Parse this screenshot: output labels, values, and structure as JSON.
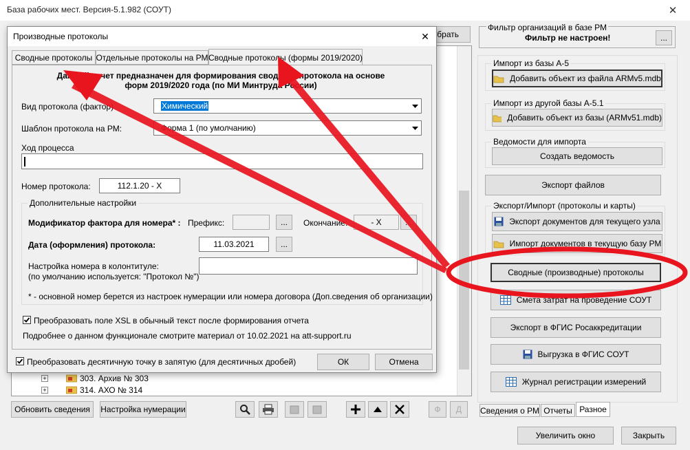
{
  "main_window": {
    "title": "База рабочих мест. Версия-5.1.982 (СОУТ)",
    "close_glyph": "✕",
    "hidden_button_label": "брать"
  },
  "tree": {
    "items": [
      {
        "text": "303. Архив № 303"
      },
      {
        "text": "314. АХО № 314"
      }
    ]
  },
  "bottom_left": {
    "refresh_label": "Обновить сведения",
    "numbering_label": "Настройка нумерации",
    "f_label": "Ф",
    "d_label": "Д"
  },
  "right_panel": {
    "filter": {
      "title": "Фильтр организаций в базе РМ",
      "status": "Фильтр не настроен!",
      "btn": "..."
    },
    "import_a5": {
      "title": "Импорт из базы А-5",
      "btn": "Добавить объект из файла ARMv5.mdb"
    },
    "import_a51": {
      "title": "Импорт из другой базы А-5.1",
      "btn": "Добавить объект из базы (ARMv51.mdb)"
    },
    "statements": {
      "title": "Ведомости для импорта",
      "btn": "Создать ведомость"
    },
    "export_files_btn": "Экспорт файлов",
    "export_import": {
      "title": "Экспорт/Импорт (протоколы и карты)",
      "export_btn": "Экспорт документов для текущего узла",
      "import_btn": "Импорт документов в текущую базу РМ"
    },
    "summary_protocols_btn": "Сводные (производные) протоколы",
    "cost_estimate_btn": "Смета затрат на проведение СОУТ",
    "fgis_rosakk_btn": "Экспорт в ФГИС Росаккредитации",
    "fgis_sout_btn": "Выгрузка в ФГИС СОУТ",
    "journal_btn": "Журнал регистрации измерений",
    "tabs": [
      "Сведения о РМ",
      "Отчеты",
      "Разное"
    ]
  },
  "footer": {
    "enlarge_label": "Увеличить окно",
    "close_label": "Закрыть"
  },
  "dialog": {
    "title": "Производные протоколы",
    "close_glyph": "✕",
    "tabs": [
      "Сводные протоколы",
      "Отдельные протоколы на РМ",
      "Сводные протоколы (формы 2019/2020)"
    ],
    "desc_line1": "Данный отчет предназначен для формирования сводного протокола на основе",
    "desc_line2": "форм 2019/2020 года (по МИ Минтруда России)",
    "factor_label": "Вид протокола (фактор)",
    "factor_value": "Химический",
    "template_label": "Шаблон протокола на РМ:",
    "template_value": "Форма 1 (по умолчанию)",
    "progress_label": "Ход процесса",
    "protocol_number_label": "Номер протокола:",
    "protocol_number_value": "112.1.20 - X",
    "extra_settings_title": "Дополнительные настройки",
    "modifier_label": "Модификатор фактора для номера* :",
    "prefix_label": "Префикс:",
    "prefix_value": "",
    "ending_label": "Окончание:",
    "ending_value": "- X",
    "date_label": "Дата (оформления) протокола:",
    "date_value": "11.03.2021",
    "footer_setting_line1": "Настройка номера  в колонтитуле:",
    "footer_setting_line2": "(по умолчанию используется: \"Протокол №\")",
    "footnote": "* - основной номер берется из настроек нумерации или номера договора (Доп.сведения об организации)",
    "xsl_checkbox_label": "Преобразовать поле XSL в обычный текст после формирования отчета",
    "more_info": "Подробнее о данном функционале смотрите материал от 10.02.2021 на att-support.ru",
    "decimal_checkbox_label": "Преобразовать десятичную точку в запятую (для десятичных дробей)",
    "ok_label": "ОК",
    "cancel_label": "Отмена",
    "browse_btn": "..."
  },
  "annotation": {
    "color": "#e8141e"
  }
}
